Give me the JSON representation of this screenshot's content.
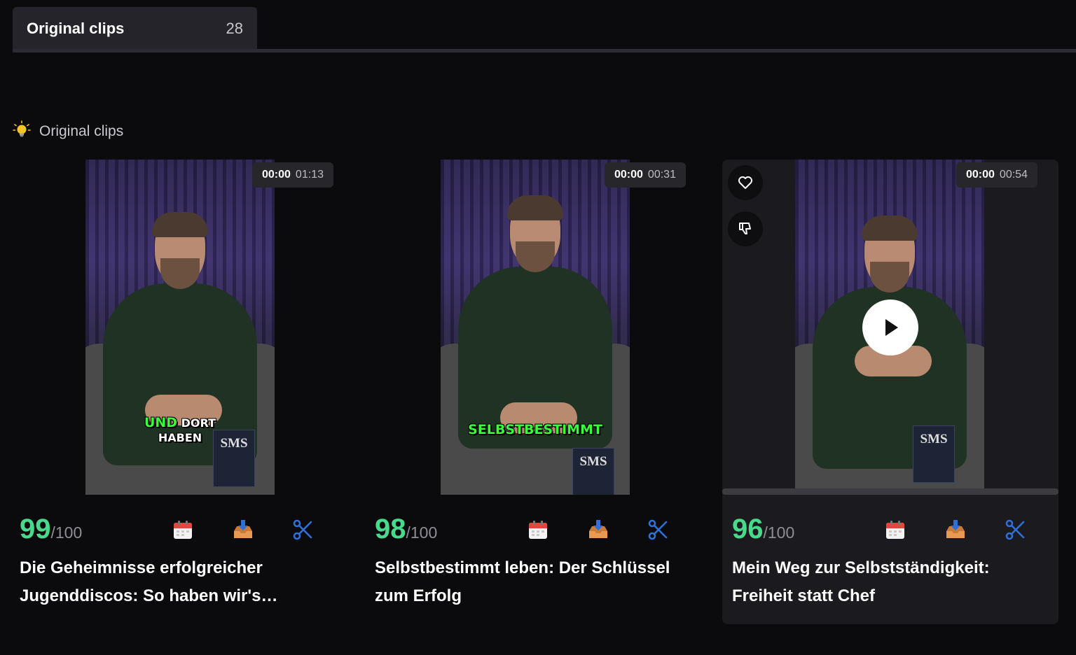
{
  "tab": {
    "label": "Original clips",
    "count": "28"
  },
  "section": {
    "title": "Original clips",
    "icon": "lightbulb-icon"
  },
  "clips": [
    {
      "time_current": "00:00",
      "duration": "01:13",
      "caption_green": "UND",
      "caption_white": "DORT",
      "caption_line2": "HABEN",
      "book_text": "SMS",
      "score": "99",
      "score_max": "/100",
      "title": "Die Geheimnisse erfolgreicher Jugenddiscos: So haben wir's…"
    },
    {
      "time_current": "00:00",
      "duration": "00:31",
      "caption_green": "SELBSTBESTIMMT",
      "book_text": "SMS",
      "score": "98",
      "score_max": "/100",
      "title": "Selbstbestimmt leben: Der Schlüssel zum Erfolg"
    },
    {
      "time_current": "00:00",
      "duration": "00:54",
      "book_text": "SMS",
      "score": "96",
      "score_max": "/100",
      "title": "Mein Weg zur Selbstständigkeit: Freiheit statt Chef"
    }
  ],
  "colors": {
    "score": "#49d98a",
    "caption_green": "#39ff3a",
    "accent_blue": "#2f6fd6"
  }
}
